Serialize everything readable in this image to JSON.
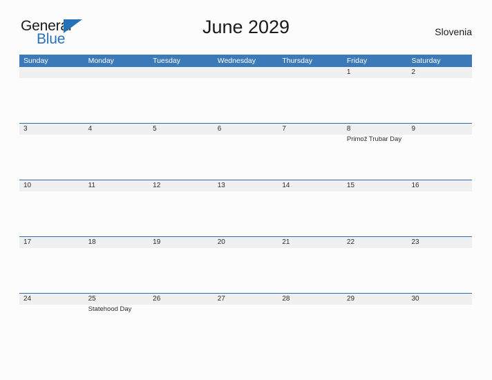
{
  "brand": {
    "name_top": "General",
    "name_bottom": "Blue",
    "triangle_color": "#2572b8",
    "text_color": "#1a1a1a"
  },
  "header": {
    "title": "June 2029",
    "country": "Slovenia"
  },
  "theme": {
    "header_blue": "#3b79b8",
    "row_line_blue": "#2f6aa8",
    "band_gray": "#f0f0f0",
    "page_background": "#fcfcfd"
  },
  "calendar": {
    "weekday_headers": [
      "Sunday",
      "Monday",
      "Tuesday",
      "Wednesday",
      "Thursday",
      "Friday",
      "Saturday"
    ],
    "weeks": [
      {
        "days": [
          {
            "num": "",
            "event": ""
          },
          {
            "num": "",
            "event": ""
          },
          {
            "num": "",
            "event": ""
          },
          {
            "num": "",
            "event": ""
          },
          {
            "num": "",
            "event": ""
          },
          {
            "num": "1",
            "event": ""
          },
          {
            "num": "2",
            "event": ""
          }
        ]
      },
      {
        "days": [
          {
            "num": "3",
            "event": ""
          },
          {
            "num": "4",
            "event": ""
          },
          {
            "num": "5",
            "event": ""
          },
          {
            "num": "6",
            "event": ""
          },
          {
            "num": "7",
            "event": ""
          },
          {
            "num": "8",
            "event": "Primož Trubar Day"
          },
          {
            "num": "9",
            "event": ""
          }
        ]
      },
      {
        "days": [
          {
            "num": "10",
            "event": ""
          },
          {
            "num": "11",
            "event": ""
          },
          {
            "num": "12",
            "event": ""
          },
          {
            "num": "13",
            "event": ""
          },
          {
            "num": "14",
            "event": ""
          },
          {
            "num": "15",
            "event": ""
          },
          {
            "num": "16",
            "event": ""
          }
        ]
      },
      {
        "days": [
          {
            "num": "17",
            "event": ""
          },
          {
            "num": "18",
            "event": ""
          },
          {
            "num": "19",
            "event": ""
          },
          {
            "num": "20",
            "event": ""
          },
          {
            "num": "21",
            "event": ""
          },
          {
            "num": "22",
            "event": ""
          },
          {
            "num": "23",
            "event": ""
          }
        ]
      },
      {
        "days": [
          {
            "num": "24",
            "event": ""
          },
          {
            "num": "25",
            "event": "Statehood Day"
          },
          {
            "num": "26",
            "event": ""
          },
          {
            "num": "27",
            "event": ""
          },
          {
            "num": "28",
            "event": ""
          },
          {
            "num": "29",
            "event": ""
          },
          {
            "num": "30",
            "event": ""
          }
        ]
      }
    ]
  }
}
